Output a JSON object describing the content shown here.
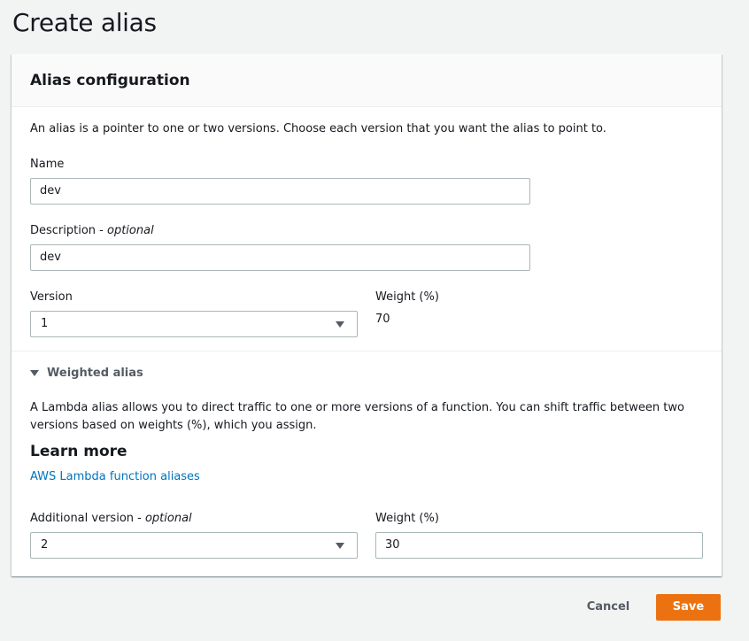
{
  "page": {
    "title": "Create alias"
  },
  "panel": {
    "title": "Alias configuration",
    "intro": "An alias is a pointer to one or two versions. Choose each version that you want the alias to point to."
  },
  "name_field": {
    "label": "Name",
    "value": "dev"
  },
  "description_field": {
    "label": "Description - ",
    "optional": "optional",
    "value": "dev"
  },
  "version_field": {
    "label": "Version",
    "selected": "1"
  },
  "weight_primary": {
    "label": "Weight (%)",
    "value": "70"
  },
  "weighted_alias": {
    "toggle_label": "Weighted alias",
    "expanded": true,
    "description_line1": "A Lambda alias allows you to direct traffic to one or more versions of a function. You can shift traffic between two",
    "description_line2": "versions based on weights (%), which you assign.",
    "learn_more_title": "Learn more",
    "link_text": "AWS Lambda function aliases"
  },
  "additional_version_field": {
    "label": "Additional version - ",
    "optional": "optional",
    "selected": "2"
  },
  "weight_additional": {
    "label": "Weight (%)",
    "value": "30"
  },
  "actions": {
    "cancel_label": "Cancel",
    "save_label": "Save"
  },
  "colors": {
    "primary_button": "#ec7211",
    "link": "#0073bb",
    "page_background": "#f2f3f3"
  }
}
